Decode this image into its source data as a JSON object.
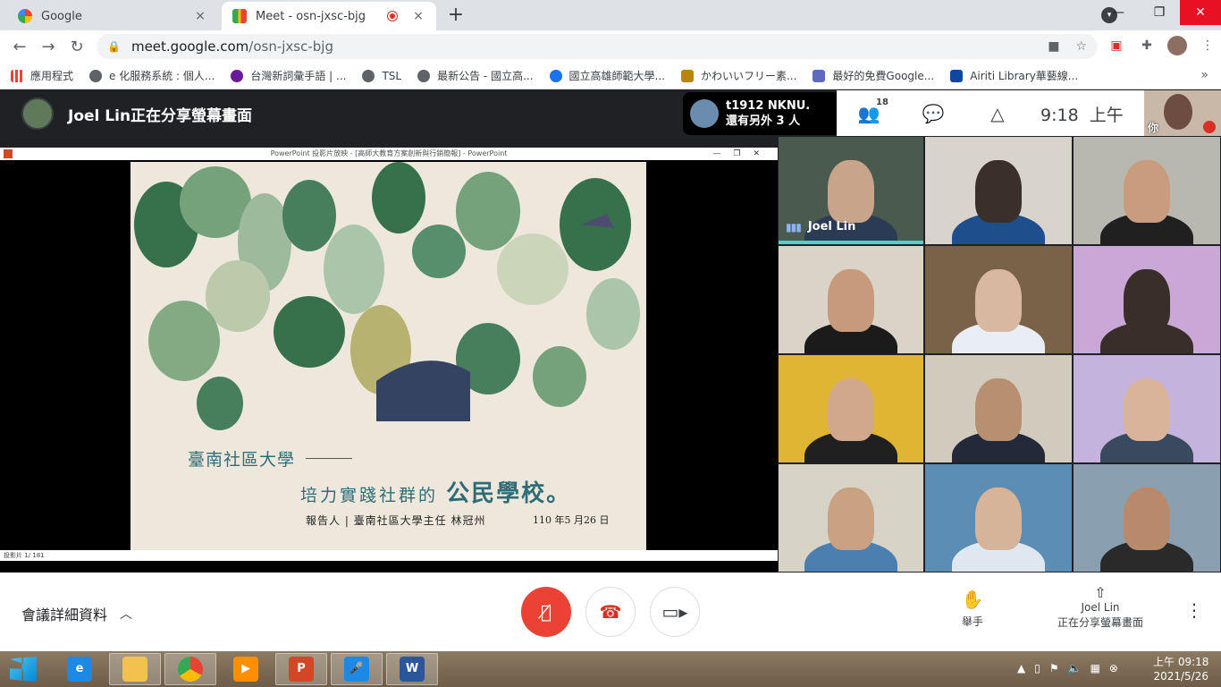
{
  "browser": {
    "tabs": [
      {
        "title": "Google",
        "active": false,
        "close": "×"
      },
      {
        "title": "Meet - osn-jxsc-bjg",
        "active": true,
        "close": "×"
      }
    ],
    "new_tab": "+",
    "url_host": "meet.google.com",
    "url_path": "/osn-jxsc-bjg",
    "bookmarks": [
      {
        "label": "應用程式",
        "color": "#ea4335"
      },
      {
        "label": "e 化服務系統 : 個人...",
        "color": "#5f6368"
      },
      {
        "label": "台灣新詞彙手語 | ...",
        "color": "#6a1b9a"
      },
      {
        "label": "TSL",
        "color": "#5f6368"
      },
      {
        "label": "最新公告 - 國立高...",
        "color": "#5f6368"
      },
      {
        "label": "國立高雄師範大學...",
        "color": "#1a73e8"
      },
      {
        "label": "かわいいフリー素...",
        "color": "#b8860b"
      },
      {
        "label": "最好的免費Google...",
        "color": "#5c6bc0"
      },
      {
        "label": "Airiti Library華藝線...",
        "color": "#0d47a1"
      }
    ],
    "bookmarks_more": "»"
  },
  "meet": {
    "presenter_text": "Joel Lin正在分享螢幕畫面",
    "other_chip": {
      "line1": "t1912 NKNU.",
      "line2": "還有另外 3 人"
    },
    "people_count": "18",
    "time": "9:18",
    "ampm": "上午",
    "self_label": "你",
    "shared": {
      "window_title": "PowerPoint 投影片放映 - [高師大教育方案創新與行銷簡報] - PowerPoint",
      "status_left": "投影片 1/ 181",
      "slide": {
        "subtitle": "臺南社區大學",
        "main_prefix": "培力實踐社群的",
        "main_emph": "公民學校。",
        "reporter": "報告人 | 臺南社區大學主任 林冠州",
        "date": "110 年5 月26 日"
      }
    },
    "participants": [
      {
        "name": "Joel Lin",
        "bg": "#4a5a4e",
        "skin": "#c8a58a",
        "shirt": "#2b3a55",
        "speaking": true
      },
      {
        "name": "",
        "bg": "#d8d4cc",
        "skin": "#3b2f2a",
        "shirt": "#1f4e8c",
        "speaking": false
      },
      {
        "name": "",
        "bg": "#b9b8b0",
        "skin": "#c99c7e",
        "shirt": "#202020",
        "speaking": false
      },
      {
        "name": "",
        "bg": "#d9d3c8",
        "skin": "#c79a7c",
        "shirt": "#1b1b1b",
        "speaking": false
      },
      {
        "name": "",
        "bg": "#7a6248",
        "skin": "#d8b8a0",
        "shirt": "#e8eef3",
        "speaking": false
      },
      {
        "name": "",
        "bg": "#c9a8d8",
        "skin": "#3a2e2a",
        "shirt": "#3a2e2a",
        "speaking": false
      },
      {
        "name": "",
        "bg": "#e0b534",
        "skin": "#d2a88c",
        "shirt": "#202020",
        "speaking": false
      },
      {
        "name": "",
        "bg": "#d0cbbd",
        "skin": "#b98f72",
        "shirt": "#222a3a",
        "speaking": false
      },
      {
        "name": "",
        "bg": "#c4b3dd",
        "skin": "#d9b49a",
        "shirt": "#3a4a5e",
        "speaking": false
      },
      {
        "name": "",
        "bg": "#d8d3c7",
        "skin": "#c8a283",
        "shirt": "#4a7fb0",
        "speaking": false
      },
      {
        "name": "",
        "bg": "#5b8db5",
        "skin": "#d6b49a",
        "shirt": "#dfe7f0",
        "speaking": false
      },
      {
        "name": "",
        "bg": "#8aa0b0",
        "skin": "#b9896c",
        "shirt": "#2a2a2a",
        "speaking": false
      }
    ],
    "controls": {
      "details_label": "會議詳細資料",
      "raise_hand": "舉手",
      "presenting_name": "Joel Lin",
      "presenting_text": "正在分享螢幕畫面"
    }
  },
  "taskbar": {
    "clock_time": "上午 09:18",
    "clock_date": "2021/5/26",
    "apps": [
      {
        "name": "ie",
        "color": "#1e88e5",
        "glyph": "e",
        "on": false
      },
      {
        "name": "explorer",
        "color": "#f2c14e",
        "glyph": "",
        "on": true
      },
      {
        "name": "chrome",
        "color": "#4caf50",
        "glyph": "",
        "on": true
      },
      {
        "name": "media",
        "color": "#ff8f00",
        "glyph": "▶",
        "on": false
      },
      {
        "name": "powerpoint",
        "color": "#d24726",
        "glyph": "P",
        "on": true
      },
      {
        "name": "voice",
        "color": "#1e88e5",
        "glyph": "🎤",
        "on": true
      },
      {
        "name": "word",
        "color": "#2b579a",
        "glyph": "W",
        "on": true
      }
    ]
  }
}
